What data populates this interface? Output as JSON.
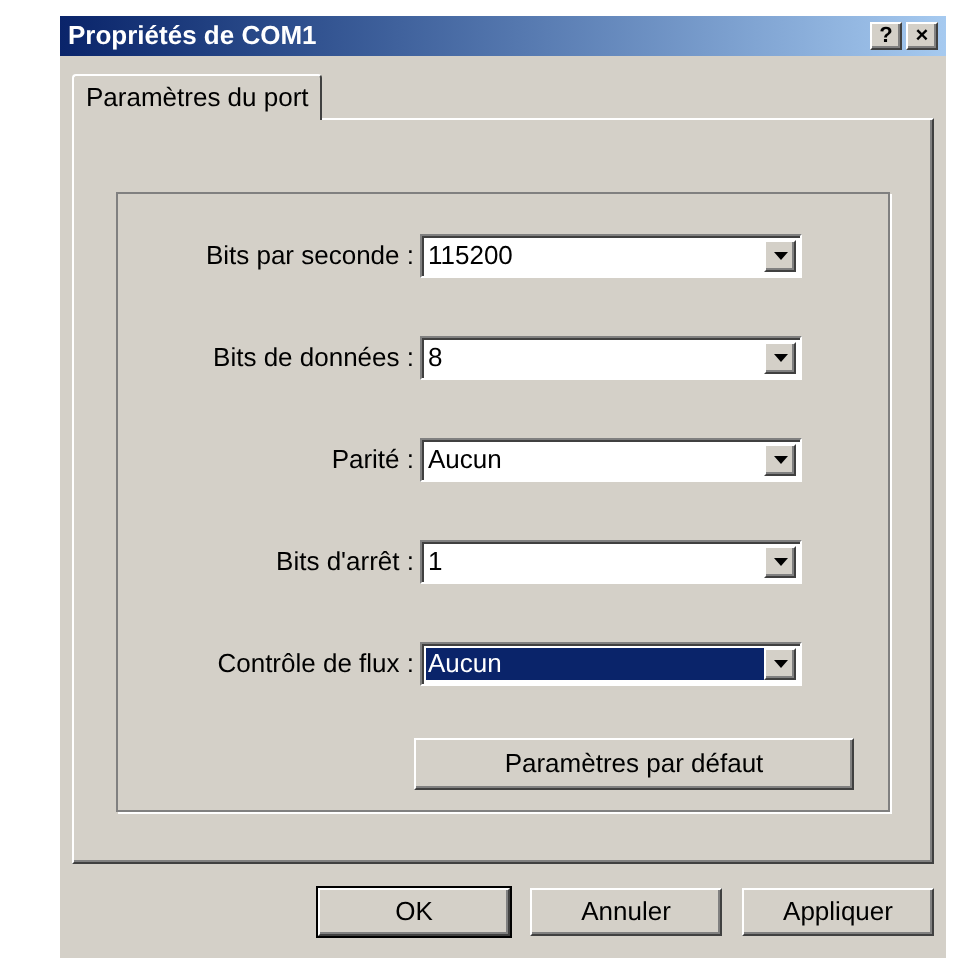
{
  "window": {
    "title": "Propriétés de COM1",
    "title_buttons": [
      "?",
      "×"
    ]
  },
  "tabs": [
    {
      "label": "Paramètres du port",
      "selected": true
    }
  ],
  "fields": [
    {
      "label": "Bits par seconde :",
      "value": "115200",
      "selected": false
    },
    {
      "label": "Bits de données :",
      "value": "8",
      "selected": false
    },
    {
      "label": "Parité :",
      "value": "Aucun",
      "selected": false
    },
    {
      "label": "Bits d'arrêt :",
      "value": "1",
      "selected": false
    },
    {
      "label": "Contrôle de flux :",
      "value": "Aucun",
      "selected": true
    }
  ],
  "defaults_button": "Paramètres par défaut",
  "buttons": [
    {
      "label": "OK",
      "default": true
    },
    {
      "label": "Annuler",
      "default": false
    },
    {
      "label": "Appliquer",
      "default": false
    }
  ]
}
